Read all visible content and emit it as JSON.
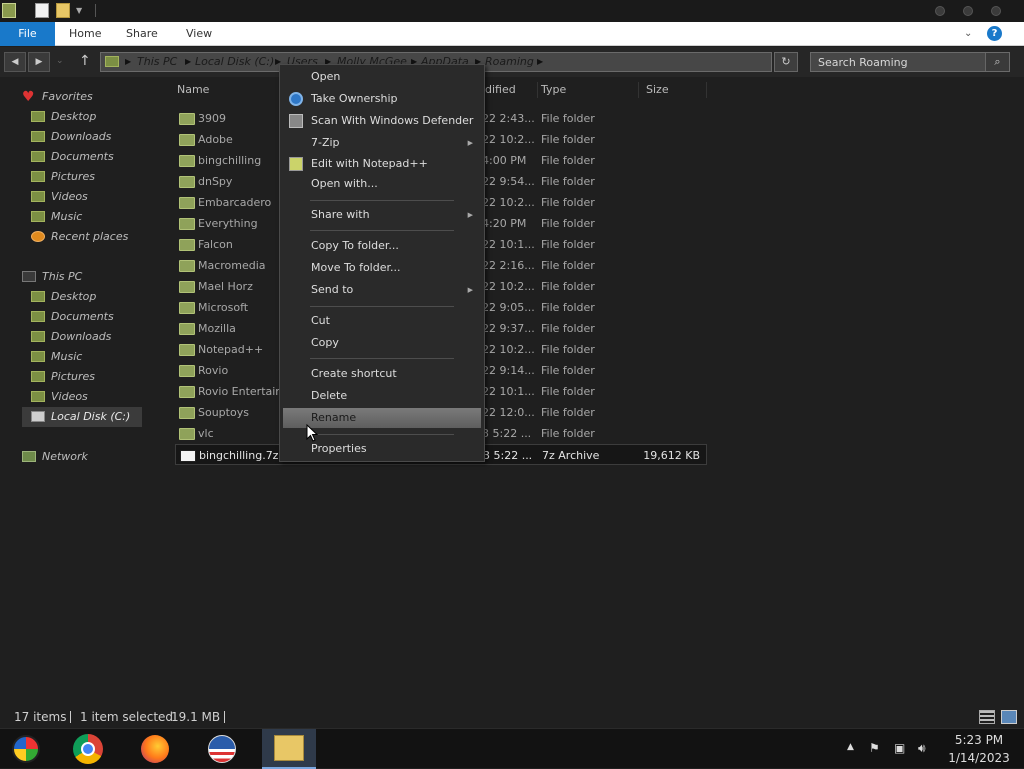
{
  "ribbon": {
    "file": "File",
    "home": "Home",
    "share": "Share",
    "view": "View"
  },
  "address": {
    "crumbs": [
      "This PC",
      "Local Disk (C:)",
      "Users",
      "Molly McGee",
      "AppData",
      "Roaming"
    ]
  },
  "search": {
    "placeholder": "Search Roaming"
  },
  "nav": {
    "favorites": "Favorites",
    "fav_items": [
      "Desktop",
      "Downloads",
      "Documents",
      "Pictures",
      "Videos",
      "Music",
      "Recent places"
    ],
    "this_pc": "This PC",
    "pc_items": [
      "Desktop",
      "Documents",
      "Downloads",
      "Music",
      "Pictures",
      "Videos",
      "Local Disk (C:)"
    ],
    "network": "Network"
  },
  "columns": {
    "name": "Name",
    "modified": "dified",
    "type": "Type",
    "size": "Size"
  },
  "files": [
    {
      "name": "3909",
      "date": "22 2:43...",
      "type": "File folder",
      "size": ""
    },
    {
      "name": "Adobe",
      "date": "22 10:2...",
      "type": "File folder",
      "size": ""
    },
    {
      "name": "bingchilling",
      "date": "4:00 PM",
      "type": "File folder",
      "size": ""
    },
    {
      "name": "dnSpy",
      "date": "22 9:54...",
      "type": "File folder",
      "size": ""
    },
    {
      "name": "Embarcadero",
      "date": "22 10:2...",
      "type": "File folder",
      "size": ""
    },
    {
      "name": "Everything",
      "date": "4:20 PM",
      "type": "File folder",
      "size": ""
    },
    {
      "name": "Falcon",
      "date": "22 10:1...",
      "type": "File folder",
      "size": ""
    },
    {
      "name": "Macromedia",
      "date": "22 2:16...",
      "type": "File folder",
      "size": ""
    },
    {
      "name": "Mael Horz",
      "date": "22 10:2...",
      "type": "File folder",
      "size": ""
    },
    {
      "name": "Microsoft",
      "date": "22 9:05...",
      "type": "File folder",
      "size": ""
    },
    {
      "name": "Mozilla",
      "date": "22 9:37...",
      "type": "File folder",
      "size": ""
    },
    {
      "name": "Notepad++",
      "date": "22 10:2...",
      "type": "File folder",
      "size": ""
    },
    {
      "name": "Rovio",
      "date": "22 9:14...",
      "type": "File folder",
      "size": ""
    },
    {
      "name": "Rovio Entertain",
      "date": "22 10:1...",
      "type": "File folder",
      "size": ""
    },
    {
      "name": "Souptoys",
      "date": "22 12:0...",
      "type": "File folder",
      "size": ""
    },
    {
      "name": "vlc",
      "date": "3 5:22 ...",
      "type": "File folder",
      "size": ""
    },
    {
      "name": "bingchilling.7z",
      "date": "3 5:22 ...",
      "type": "7z Archive",
      "size": "19,612 KB"
    }
  ],
  "context_menu": {
    "open": "Open",
    "take_ownership": "Take Ownership",
    "scan": "Scan With Windows Defender",
    "zip": "7-Zip",
    "notepad": "Edit with Notepad++",
    "open_with": "Open with...",
    "share_with": "Share with",
    "copy_to": "Copy To folder...",
    "move_to": "Move To folder...",
    "send_to": "Send to",
    "cut": "Cut",
    "copy": "Copy",
    "create_shortcut": "Create shortcut",
    "delete": "Delete",
    "rename": "Rename",
    "properties": "Properties"
  },
  "status": {
    "items": "17 items",
    "selected": "1 item selected",
    "size": "19.1 MB"
  },
  "taskbar": {
    "time": "5:23 PM",
    "date": "1/14/2023"
  },
  "colors": {
    "accent": "#1979ca",
    "folder": "#8fa25a",
    "highlight": "#6e6e6e"
  }
}
